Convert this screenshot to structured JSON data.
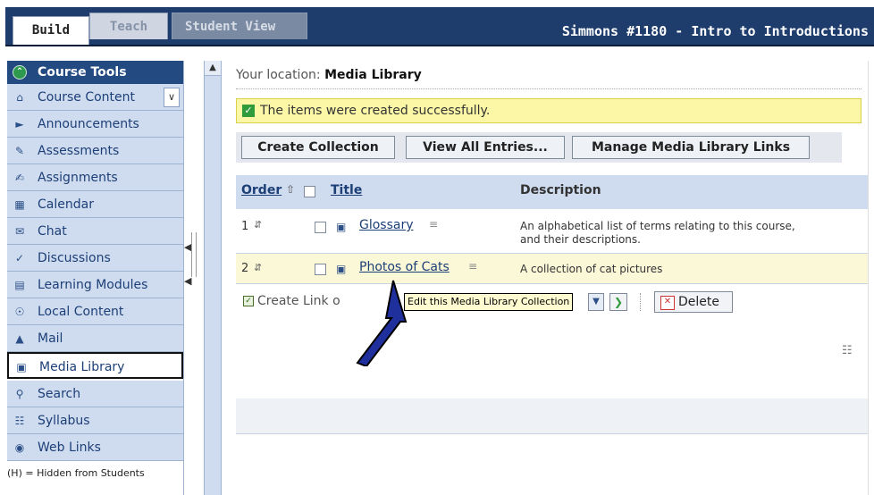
{
  "tabs": [
    {
      "label": "Build",
      "active": true
    },
    {
      "label": "Teach",
      "active": false
    },
    {
      "label": "Student View",
      "active": false
    }
  ],
  "course_title": "Simmons #1180 - Intro to Introductions",
  "sidebar": {
    "header": "Course Tools",
    "items": [
      {
        "label": "Course Content",
        "icon": "home-icon"
      },
      {
        "label": "Announcements",
        "icon": "megaphone-icon"
      },
      {
        "label": "Assessments",
        "icon": "assessment-icon"
      },
      {
        "label": "Assignments",
        "icon": "assignment-icon"
      },
      {
        "label": "Calendar",
        "icon": "calendar-icon"
      },
      {
        "label": "Chat",
        "icon": "chat-icon"
      },
      {
        "label": "Discussions",
        "icon": "discussion-icon"
      },
      {
        "label": "Learning Modules",
        "icon": "module-icon"
      },
      {
        "label": "Local Content",
        "icon": "local-content-icon"
      },
      {
        "label": "Mail",
        "icon": "mail-icon"
      },
      {
        "label": "Media Library",
        "icon": "media-library-icon",
        "selected": true
      },
      {
        "label": "Search",
        "icon": "search-icon"
      },
      {
        "label": "Syllabus",
        "icon": "syllabus-icon"
      },
      {
        "label": "Web Links",
        "icon": "web-links-icon"
      }
    ],
    "footer": "(H) = Hidden from Students"
  },
  "main": {
    "location_label": "Your location:",
    "location_value": "Media Library",
    "success_message": "The items were created successfully.",
    "buttons": {
      "create_collection": "Create Collection",
      "view_all_entries": "View All Entries...",
      "manage_links": "Manage Media Library Links"
    },
    "table": {
      "headers": {
        "order": "Order",
        "title": "Title",
        "description": "Description"
      },
      "rows": [
        {
          "order": "1",
          "title": "Glossary",
          "description": "An alphabetical list of terms relating to this course, and their descriptions."
        },
        {
          "order": "2",
          "title": "Photos of Cats",
          "description": "A collection of cat pictures"
        }
      ]
    },
    "footer": {
      "create_link_text": "Create Link o",
      "tooltip": "Edit this Media Library Collection",
      "delete_label": "Delete"
    }
  },
  "colors": {
    "brand_navy": "#1e3c6c",
    "nav_bg": "#cfdcef",
    "success_bg": "#fbf7a6",
    "annotation_arrow": "#1f2f9c"
  }
}
